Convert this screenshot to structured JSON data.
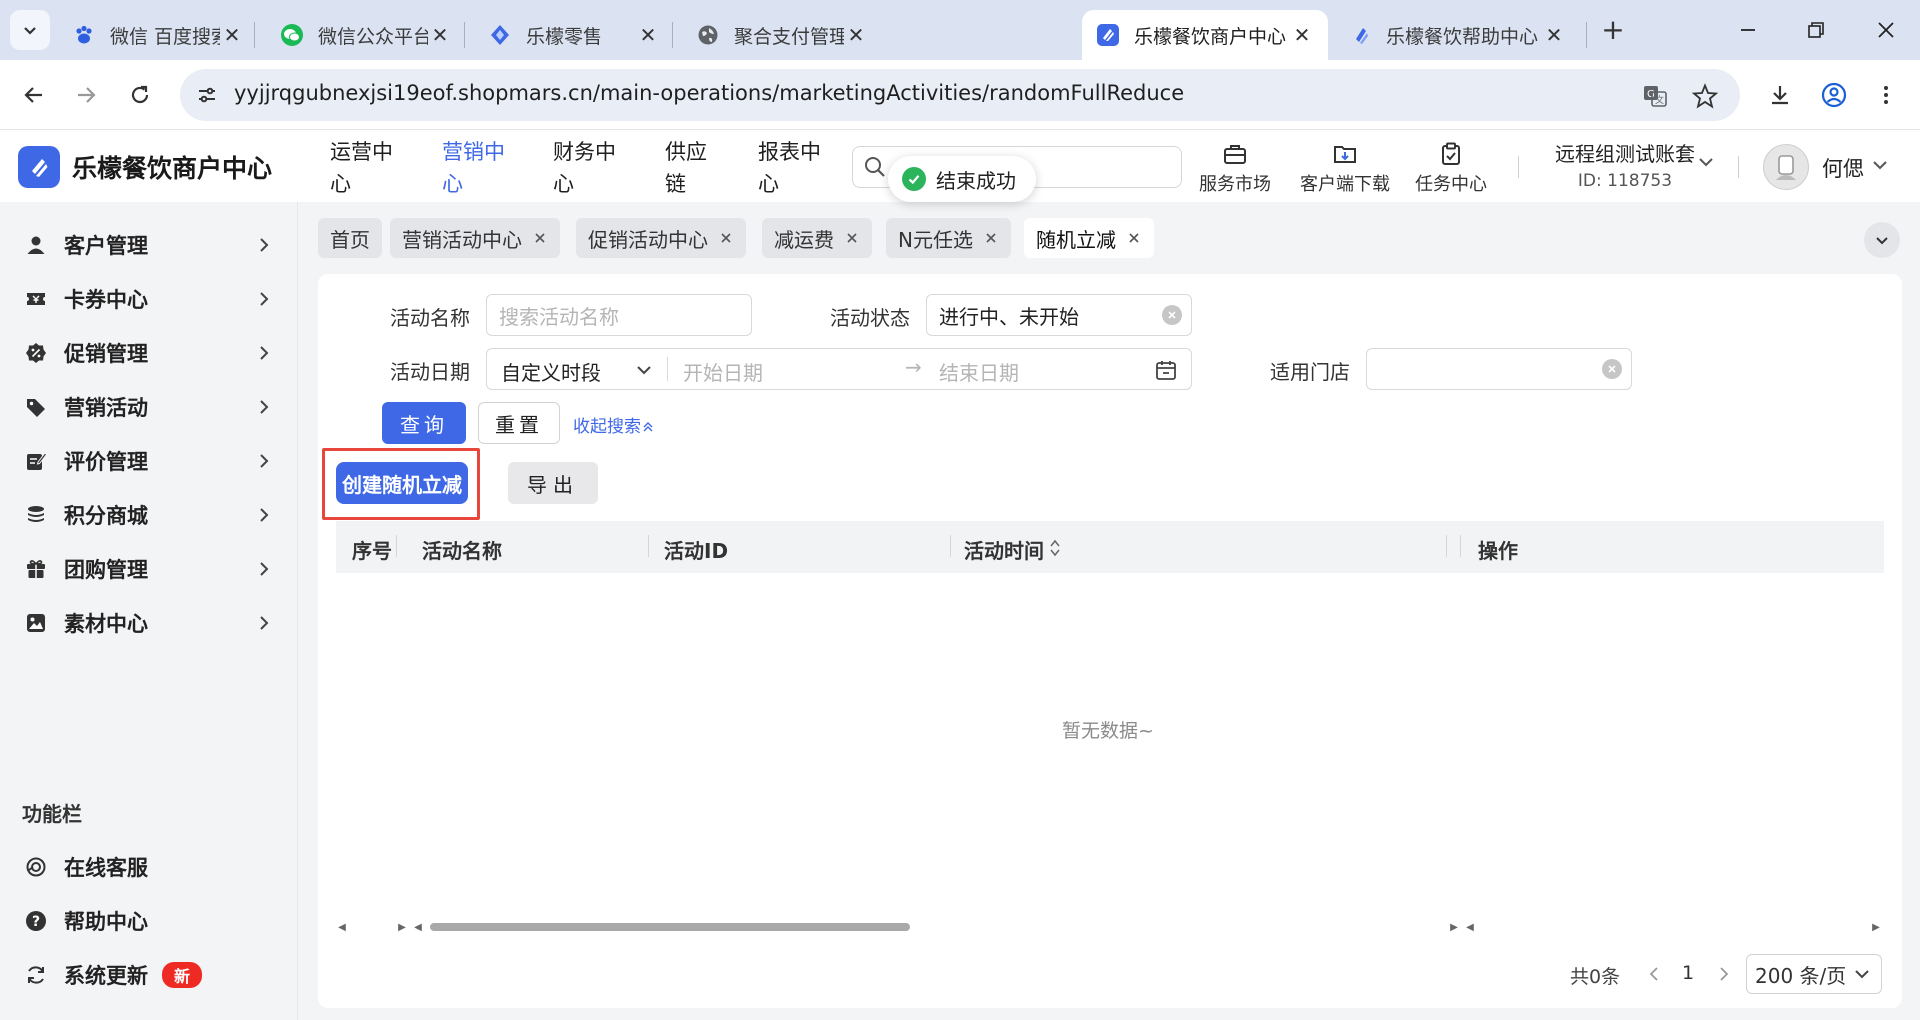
{
  "browser": {
    "tabs": [
      {
        "title": "微信 百度搜索",
        "icon": "baidu-paw-icon",
        "active": false
      },
      {
        "title": "微信公众平台",
        "icon": "wechat-icon",
        "active": false
      },
      {
        "title": "乐檬零售",
        "icon": "lemon-diamond-icon",
        "active": false
      },
      {
        "title": "聚合支付管理平台",
        "icon": "globe-icon",
        "active": false
      },
      {
        "title": "乐檬餐饮商户中心",
        "icon": "lemon-logo-icon",
        "active": true
      },
      {
        "title": "乐檬餐饮帮助中心",
        "icon": "lemon-diamond-icon",
        "active": false
      }
    ],
    "url": "yyjjrqgubnexjsi19eof.shopmars.cn/main-operations/marketingActivities/randomFullReduce"
  },
  "app": {
    "brand": "乐檬餐饮商户中心",
    "top_nav": [
      {
        "label": "运营中心",
        "active": false
      },
      {
        "label": "营销中心",
        "active": true
      },
      {
        "label": "财务中心",
        "active": false
      },
      {
        "label": "供应链",
        "active": false
      },
      {
        "label": "报表中心",
        "active": false
      }
    ],
    "toast": "结束成功",
    "tools": [
      {
        "label": "服务市场",
        "icon": "briefcase-icon"
      },
      {
        "label": "客户端下载",
        "icon": "download-folder-icon"
      },
      {
        "label": "任务中心",
        "icon": "clipboard-check-icon"
      }
    ],
    "account": {
      "name": "远程组测试账套",
      "id": "ID: 118753"
    },
    "user": "何偲"
  },
  "sidebar": {
    "items": [
      {
        "label": "客户管理",
        "icon": "user-icon"
      },
      {
        "label": "卡券中心",
        "icon": "ticket-icon"
      },
      {
        "label": "促销管理",
        "icon": "discount-badge-icon"
      },
      {
        "label": "营销活动",
        "icon": "tag-icon"
      },
      {
        "label": "评价管理",
        "icon": "edit-review-icon"
      },
      {
        "label": "积分商城",
        "icon": "coins-stack-icon"
      },
      {
        "label": "团购管理",
        "icon": "gift-icon"
      },
      {
        "label": "素材中心",
        "icon": "image-icon"
      }
    ],
    "func_title": "功能栏",
    "func_items": [
      {
        "label": "在线客服",
        "icon": "headset-icon"
      },
      {
        "label": "帮助中心",
        "icon": "help-circle-icon"
      },
      {
        "label": "系统更新",
        "icon": "refresh-icon",
        "badge": "新"
      }
    ]
  },
  "page_tabs": [
    {
      "label": "首页",
      "closable": false,
      "active": false
    },
    {
      "label": "营销活动中心",
      "closable": true,
      "active": false
    },
    {
      "label": "促销活动中心",
      "closable": true,
      "active": false
    },
    {
      "label": "减运费",
      "closable": true,
      "active": false
    },
    {
      "label": "N元任选",
      "closable": true,
      "active": false
    },
    {
      "label": "随机立减",
      "closable": true,
      "active": true
    }
  ],
  "filters": {
    "name_label": "活动名称",
    "name_placeholder": "搜索活动名称",
    "status_label": "活动状态",
    "status_value": "进行中、未开始",
    "date_label": "活动日期",
    "date_mode": "自定义时段",
    "start_placeholder": "开始日期",
    "end_placeholder": "结束日期",
    "store_label": "适用门店",
    "query_button": "查询",
    "reset_button": "重置",
    "collapse_link": "收起搜索"
  },
  "actions": {
    "create_button": "创建随机立减",
    "export_button": "导出"
  },
  "table": {
    "columns": [
      "序号",
      "活动名称",
      "活动ID",
      "活动时间",
      "操作"
    ],
    "empty_text": "暂无数据~"
  },
  "pagination": {
    "total": "共0条",
    "current_page": "1",
    "page_size": "200 条/页"
  }
}
